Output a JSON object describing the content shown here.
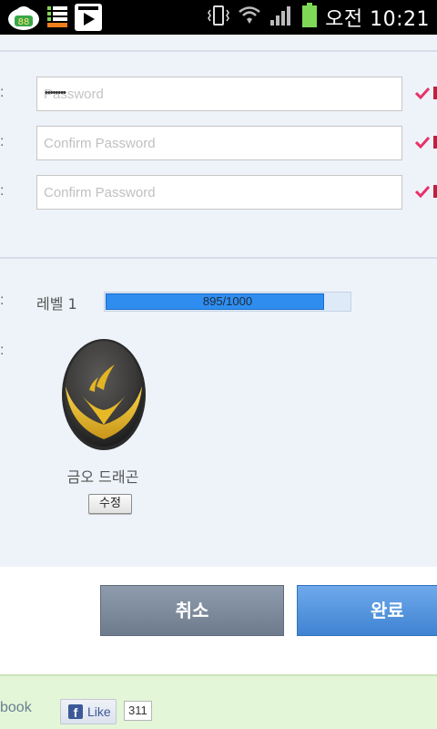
{
  "status_bar": {
    "time": "오전 10:21",
    "app_badge": "88",
    "icons": [
      "app-notification-icon",
      "list-icon",
      "play-store-icon",
      "vibrate-icon",
      "wifi-icon",
      "signal-icon",
      "battery-icon"
    ]
  },
  "form": {
    "rows": [
      {
        "label": ":",
        "placeholder": "Password",
        "value": "••••••••"
      },
      {
        "label": ":",
        "placeholder": "Confirm Password",
        "value": ""
      },
      {
        "label": ":",
        "placeholder": "Confirm Password",
        "value": ""
      }
    ],
    "check_color": "#e8326a"
  },
  "level": {
    "label": ":",
    "text": "레벨 1",
    "progress_text": "895/1000",
    "progress_fraction": 0.895
  },
  "dragon": {
    "label": ":",
    "name": "금오 드래곤",
    "edit_label": "수정"
  },
  "actions": {
    "cancel_label": "취소",
    "done_label": "완료"
  },
  "footer": {
    "text": "book",
    "like_label": "Like",
    "like_count": "311"
  },
  "colors": {
    "accent": "#2f8df0",
    "panel_bg": "#eef3f9",
    "footer_bg": "#e3f6d8"
  }
}
